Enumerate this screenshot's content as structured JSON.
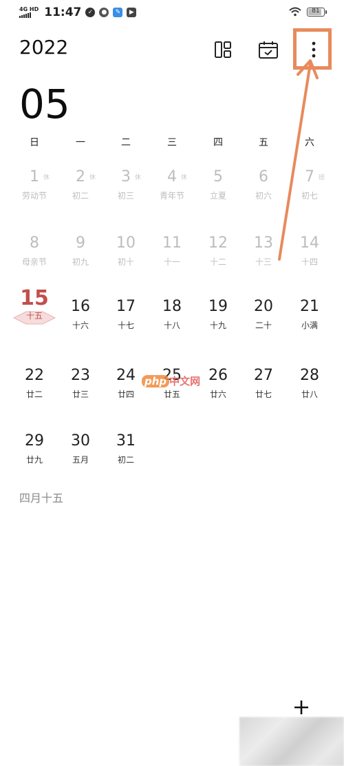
{
  "status_bar": {
    "network": "4G HD",
    "time": "11:47",
    "battery": "81",
    "icons": [
      "signal-icon",
      "wifi-icon",
      "battery-icon"
    ]
  },
  "header": {
    "year": "2022",
    "month": "05",
    "layout_icon": "layout-icon",
    "today_icon": "calendar-check-icon",
    "more_icon": "more-vertical-icon"
  },
  "weekdays": [
    "日",
    "一",
    "二",
    "三",
    "四",
    "五",
    "六"
  ],
  "days": [
    {
      "num": "1",
      "sub": "劳动节",
      "rest": "休",
      "state": "past"
    },
    {
      "num": "2",
      "sub": "初二",
      "rest": "休",
      "state": "past"
    },
    {
      "num": "3",
      "sub": "初三",
      "rest": "休",
      "state": "past"
    },
    {
      "num": "4",
      "sub": "青年节",
      "rest": "休",
      "state": "past"
    },
    {
      "num": "5",
      "sub": "立夏",
      "rest": "",
      "state": "past"
    },
    {
      "num": "6",
      "sub": "初六",
      "rest": "",
      "state": "past"
    },
    {
      "num": "7",
      "sub": "初七",
      "rest": "班",
      "state": "past"
    },
    {
      "num": "8",
      "sub": "母亲节",
      "rest": "",
      "state": "past"
    },
    {
      "num": "9",
      "sub": "初九",
      "rest": "",
      "state": "past"
    },
    {
      "num": "10",
      "sub": "初十",
      "rest": "",
      "state": "past"
    },
    {
      "num": "11",
      "sub": "十一",
      "rest": "",
      "state": "past"
    },
    {
      "num": "12",
      "sub": "十二",
      "rest": "",
      "state": "past"
    },
    {
      "num": "13",
      "sub": "十三",
      "rest": "",
      "state": "past"
    },
    {
      "num": "14",
      "sub": "十四",
      "rest": "",
      "state": "past"
    },
    {
      "num": "15",
      "sub": "十五",
      "rest": "",
      "state": "today"
    },
    {
      "num": "16",
      "sub": "十六",
      "rest": "",
      "state": "current"
    },
    {
      "num": "17",
      "sub": "十七",
      "rest": "",
      "state": "current"
    },
    {
      "num": "18",
      "sub": "十八",
      "rest": "",
      "state": "current"
    },
    {
      "num": "19",
      "sub": "十九",
      "rest": "",
      "state": "current"
    },
    {
      "num": "20",
      "sub": "二十",
      "rest": "",
      "state": "current"
    },
    {
      "num": "21",
      "sub": "小满",
      "rest": "",
      "state": "current"
    },
    {
      "num": "22",
      "sub": "廿二",
      "rest": "",
      "state": "current"
    },
    {
      "num": "23",
      "sub": "廿三",
      "rest": "",
      "state": "current"
    },
    {
      "num": "24",
      "sub": "廿四",
      "rest": "",
      "state": "current"
    },
    {
      "num": "25",
      "sub": "廿五",
      "rest": "",
      "state": "current"
    },
    {
      "num": "26",
      "sub": "廿六",
      "rest": "",
      "state": "current"
    },
    {
      "num": "27",
      "sub": "廿七",
      "rest": "",
      "state": "current"
    },
    {
      "num": "28",
      "sub": "廿八",
      "rest": "",
      "state": "current"
    },
    {
      "num": "29",
      "sub": "廿九",
      "rest": "",
      "state": "current"
    },
    {
      "num": "30",
      "sub": "五月",
      "rest": "",
      "state": "current"
    },
    {
      "num": "31",
      "sub": "初二",
      "rest": "",
      "state": "current"
    }
  ],
  "selected_lunar_date": "四月十五",
  "watermark": {
    "logo": "php",
    "text": "中文网"
  },
  "add_icon": "plus-icon",
  "colors": {
    "today": "#c0504d",
    "annotation": "#e88a5c",
    "past": "#bdbdbd"
  }
}
